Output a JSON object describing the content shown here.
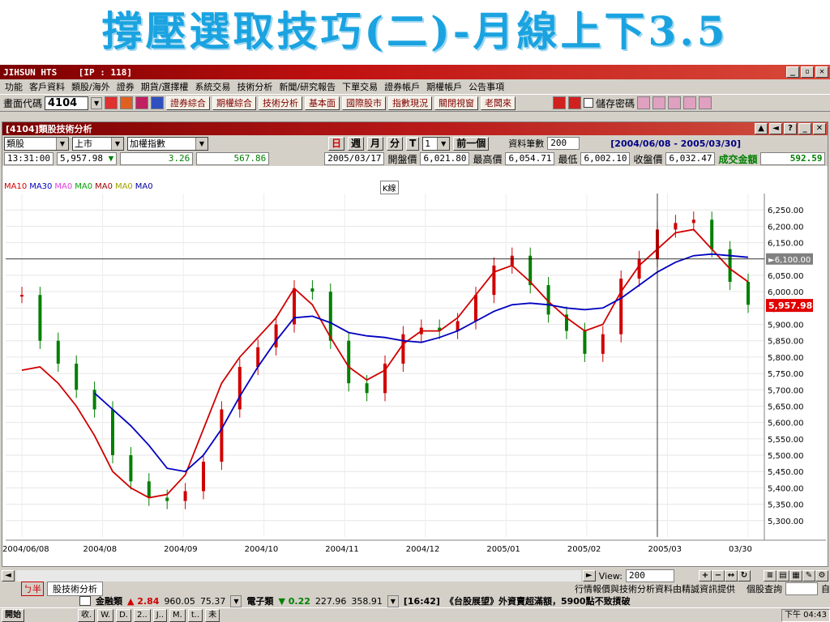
{
  "slide": {
    "title": "撐壓選取技巧(二)-月線上下3.5"
  },
  "app": {
    "title": "JIHSUN HTS",
    "ip": "[IP : 118]"
  },
  "menu": [
    "功能",
    "客戶資料",
    "類股/海外",
    "證券",
    "期貨/選擇權",
    "系統交易",
    "技術分析",
    "新聞/研究報告",
    "下單交易",
    "證券帳戶",
    "期權帳戶",
    "公告事項"
  ],
  "toolbar": {
    "code_label": "畫面代碼",
    "code_value": "4104",
    "buttons": [
      "證券綜合",
      "期權綜合",
      "技術分析",
      "基本面",
      "國際股市",
      "指數現況",
      "關閉視窗",
      "老闆來"
    ],
    "save_password_label": "儲存密碼"
  },
  "subwindow": {
    "title": "[4104]類股技術分析",
    "select1": "類股",
    "select2": "上市",
    "select3": "加權指數",
    "period_buttons": [
      "日",
      "週",
      "月",
      "分",
      "T"
    ],
    "period_count": "1",
    "prev_button": "前一個",
    "records_label": "資料筆數",
    "records_value": "200",
    "date_range": "[2004/06/08 - 2005/03/30]"
  },
  "info": {
    "time": "13:31:00",
    "price": "5,957.98",
    "arrow": "▼",
    "change": "3.26",
    "volume": "567.86",
    "date": "2005/03/17",
    "open_label": "開盤價",
    "open": "6,021.80",
    "high_label": "最高價",
    "high": "6,054.71",
    "low_label": "最低",
    "low": "6,002.10",
    "close_label": "收盤價",
    "close": "6,032.47",
    "amount_label": "成交金額",
    "amount": "592.59"
  },
  "legend": [
    {
      "label": "MA10",
      "color": "#d00000"
    },
    {
      "label": "MA30",
      "color": "#0000c0"
    },
    {
      "label": "MA0",
      "color": "#e040e0"
    },
    {
      "label": "MA0",
      "color": "#00a000"
    },
    {
      "label": "MA0",
      "color": "#a00000"
    },
    {
      "label": "MA0",
      "color": "#a0a000"
    },
    {
      "label": "MA0",
      "color": "#0000a0"
    }
  ],
  "k_tag": "K線",
  "chart_data": {
    "type": "line",
    "ylim": [
      5250,
      6300
    ],
    "y_ticks": [
      "6,250.00",
      "6,200.00",
      "6,150.00",
      "6,100.00",
      "6,050.00",
      "6,000.00",
      "5,950.00",
      "5,900.00",
      "5,850.00",
      "5,800.00",
      "5,750.00",
      "5,700.00",
      "5,650.00",
      "5,600.00",
      "5,550.00",
      "5,500.00",
      "5,450.00",
      "5,400.00",
      "5,350.00",
      "5,300.00"
    ],
    "x_ticks": [
      "2004/06/08",
      "2004/08",
      "2004/09",
      "2004/10",
      "2004/11",
      "2004/12",
      "2005/01",
      "2005/02",
      "2005/03",
      "03/30"
    ],
    "crosshair_value": "6,100.00",
    "last_price": "5,957.98",
    "series": [
      {
        "name": "MA10",
        "color": "#d00000",
        "values": [
          5760,
          5770,
          5720,
          5650,
          5560,
          5450,
          5400,
          5370,
          5380,
          5440,
          5580,
          5720,
          5800,
          5860,
          5920,
          6010,
          5960,
          5860,
          5770,
          5730,
          5760,
          5840,
          5880,
          5880,
          5920,
          5990,
          6060,
          6080,
          6030,
          5970,
          5920,
          5880,
          5900,
          6000,
          6080,
          6130,
          6180,
          6190,
          6130,
          6070,
          6030
        ]
      },
      {
        "name": "MA30",
        "color": "#0000c0",
        "values": [
          null,
          null,
          null,
          null,
          5690,
          5640,
          5590,
          5530,
          5460,
          5450,
          5500,
          5580,
          5680,
          5770,
          5850,
          5920,
          5925,
          5905,
          5875,
          5865,
          5860,
          5850,
          5845,
          5860,
          5880,
          5910,
          5940,
          5960,
          5965,
          5960,
          5950,
          5945,
          5950,
          5980,
          6020,
          6060,
          6090,
          6110,
          6115,
          6110,
          6105
        ]
      }
    ],
    "candles": [
      5990,
      5850,
      5780,
      5700,
      5640,
      5500,
      5420,
      5370,
      5360,
      5390,
      5480,
      5640,
      5770,
      5830,
      5900,
      6010,
      6000,
      5850,
      5720,
      5690,
      5780,
      5870,
      5890,
      5880,
      5910,
      5990,
      6080,
      6110,
      6020,
      5930,
      5880,
      5810,
      5870,
      6040,
      6100,
      6190,
      6210,
      6220,
      6130,
      6030,
      5960
    ]
  },
  "view": {
    "label": "View:",
    "value": "200"
  },
  "tab": {
    "label": "股技術分析",
    "footer_text": "行情報價與技術分析資料由精誠資訊提供",
    "stock_query": "個股查詢",
    "self": "自"
  },
  "quotes": {
    "finance_label": "金融類",
    "finance_change": "2.84",
    "finance_v1": "960.05",
    "finance_v2": "75.37",
    "elec_label": "電子類",
    "elec_change": "0.22",
    "elec_v1": "227.96",
    "elec_v2": "358.91",
    "news_time": "[16:42]",
    "news_text": "《台股展望》外資賣超滿額，5900點不致摃破"
  },
  "taskbar": {
    "start": "開始",
    "items": [
      "收.",
      "W.",
      "D.",
      "2..",
      "J..",
      "M.",
      "t..",
      "未"
    ],
    "clock": "下午 04:43"
  }
}
